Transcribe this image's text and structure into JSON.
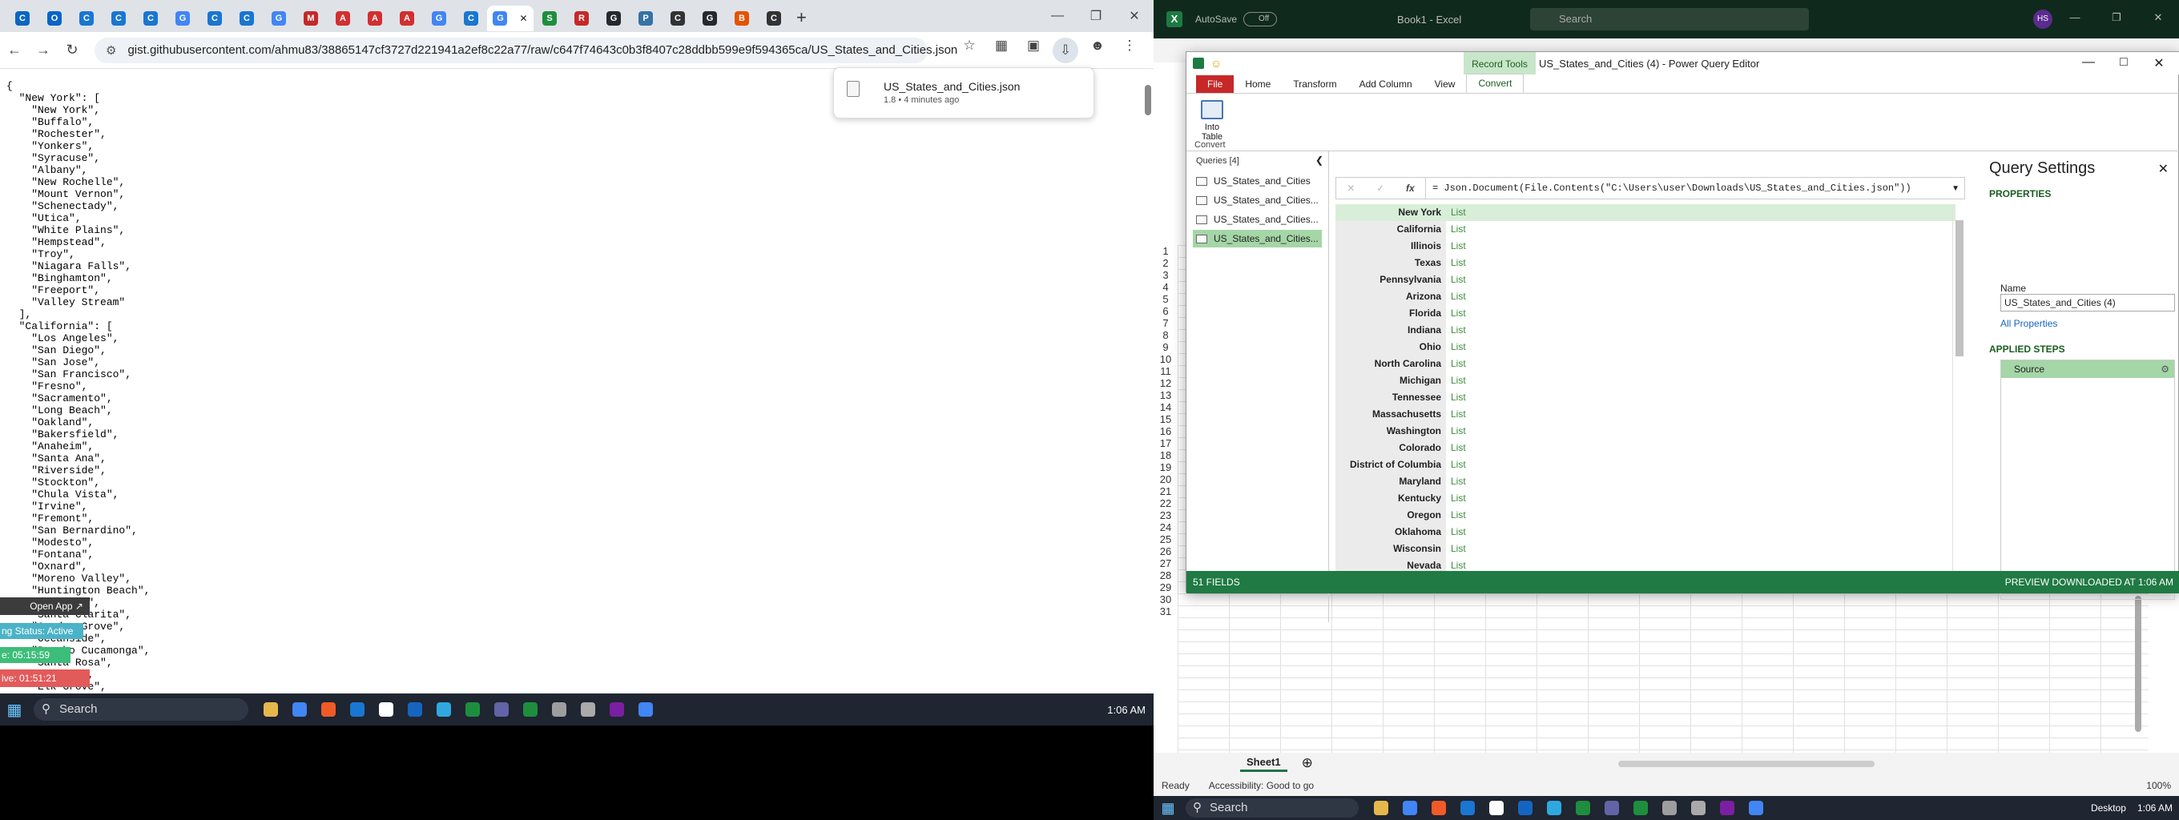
{
  "chrome": {
    "tabs": [
      {
        "icon": "cycle-icon",
        "color": "#0a66c2",
        "letter": "C"
      },
      {
        "icon": "outlook-icon",
        "color": "#0a64c8",
        "letter": "O"
      },
      {
        "icon": "cycle-icon",
        "color": "#1976d2",
        "letter": "C"
      },
      {
        "icon": "cycle-icon",
        "color": "#1976d2",
        "letter": "C"
      },
      {
        "icon": "cycle-icon",
        "color": "#1976d2",
        "letter": "C"
      },
      {
        "icon": "google-icon",
        "color": "#4285f4",
        "letter": "G"
      },
      {
        "icon": "cycle-icon",
        "color": "#1976d2",
        "letter": "C"
      },
      {
        "icon": "cycle-icon",
        "color": "#1976d2",
        "letter": "C"
      },
      {
        "icon": "google-icon",
        "color": "#4285f4",
        "letter": "G"
      },
      {
        "icon": "gmail-icon",
        "color": "#c62828",
        "letter": "M"
      },
      {
        "icon": "red-app-icon",
        "color": "#d32f2f",
        "letter": "A"
      },
      {
        "icon": "red-app-icon",
        "color": "#d32f2f",
        "letter": "A"
      },
      {
        "icon": "red-app-icon",
        "color": "#d32f2f",
        "letter": "A"
      },
      {
        "icon": "google-icon",
        "color": "#4285f4",
        "letter": "G"
      },
      {
        "icon": "cycle-icon",
        "color": "#1976d2",
        "letter": "C"
      }
    ],
    "active_tab_letter": "G",
    "tabs_after": [
      {
        "icon": "sheets-icon",
        "color": "#1e8e3e",
        "letter": "S"
      },
      {
        "icon": "red-app-icon",
        "color": "#c62828",
        "letter": "R"
      },
      {
        "icon": "github-icon",
        "color": "#24292f",
        "letter": "G"
      },
      {
        "icon": "python-icon",
        "color": "#3572a5",
        "letter": "P"
      },
      {
        "icon": "chatgpt-icon",
        "color": "#333333",
        "letter": "C"
      },
      {
        "icon": "github-icon",
        "color": "#24292f",
        "letter": "G"
      },
      {
        "icon": "brave-icon",
        "color": "#e65100",
        "letter": "B"
      },
      {
        "icon": "chatgpt-icon",
        "color": "#333333",
        "letter": "C"
      }
    ],
    "url": "gist.githubusercontent.com/ahmu83/38865147cf3727d221941a2ef8c22a77/raw/c647f74643c0b3f8407c28ddbb599e9f594365ca/US_States_and_Cities.json",
    "json_text": "{\n  \"New York\": [\n    \"New York\",\n    \"Buffalo\",\n    \"Rochester\",\n    \"Yonkers\",\n    \"Syracuse\",\n    \"Albany\",\n    \"New Rochelle\",\n    \"Mount Vernon\",\n    \"Schenectady\",\n    \"Utica\",\n    \"White Plains\",\n    \"Hempstead\",\n    \"Troy\",\n    \"Niagara Falls\",\n    \"Binghamton\",\n    \"Freeport\",\n    \"Valley Stream\"\n  ],\n  \"California\": [\n    \"Los Angeles\",\n    \"San Diego\",\n    \"San Jose\",\n    \"San Francisco\",\n    \"Fresno\",\n    \"Sacramento\",\n    \"Long Beach\",\n    \"Oakland\",\n    \"Bakersfield\",\n    \"Anaheim\",\n    \"Santa Ana\",\n    \"Riverside\",\n    \"Stockton\",\n    \"Chula Vista\",\n    \"Irvine\",\n    \"Fremont\",\n    \"San Bernardino\",\n    \"Modesto\",\n    \"Fontana\",\n    \"Oxnard\",\n    \"Moreno Valley\",\n    \"Huntington Beach\",\n    \"Glendale\",\n    \"Santa Clarita\",\n    \"Garden Grove\",\n    \"Oceanside\",\n    \"Rancho Cucamonga\",\n    \"Santa Rosa\",\n    \"Ontario\",\n    \"Elk Grove\",\n    \"Corona\",",
    "download": {
      "filename": "US_States_and_Cities.json",
      "meta": "1.8 • 4 minutes ago"
    },
    "overlays": {
      "open_app": "Open App ↗",
      "status": "ng Status: Active",
      "timer1": "e: 05:15:59",
      "timer2": "ive: 01:51:21"
    },
    "taskbar": {
      "search": "Search",
      "clock": "1:06 AM"
    }
  },
  "excel": {
    "autosave": "AutoSave",
    "autosave_state": "Off",
    "book": "Book1 - Excel",
    "search": "Search",
    "avatar": "HS",
    "rows": [
      "1",
      "2",
      "3",
      "4",
      "5",
      "6",
      "7",
      "8",
      "9",
      "10",
      "11",
      "12",
      "13",
      "14",
      "15",
      "16",
      "17",
      "18",
      "19",
      "20",
      "21",
      "22",
      "23",
      "24",
      "25",
      "26",
      "27",
      "28",
      "29",
      "30",
      "31"
    ],
    "sheet": "Sheet1",
    "status_ready": "Ready",
    "status_acc": "Accessibility: Good to go",
    "status_zoom": "100%",
    "taskbar_search": "Search",
    "taskbar_clock": "1:06 AM",
    "taskbar_desktop": "Desktop"
  },
  "pq": {
    "record_tools": "Record Tools",
    "title": "US_States_and_Cities (4) - Power Query Editor",
    "tabs": [
      "File",
      "Home",
      "Transform",
      "Add Column",
      "View",
      "Convert"
    ],
    "ribbon_button": "Into Table",
    "ribbon_group": "Convert",
    "queries_header": "Queries [4]",
    "queries": [
      "US_States_and_Cities",
      "US_States_and_Cities...",
      "US_States_and_Cities...",
      "US_States_and_Cities..."
    ],
    "formula": "= Json.Document(File.Contents(\"C:\\Users\\user\\Downloads\\US_States_and_Cities.json\"))",
    "fields": [
      [
        "New York",
        "List"
      ],
      [
        "California",
        "List"
      ],
      [
        "Illinois",
        "List"
      ],
      [
        "Texas",
        "List"
      ],
      [
        "Pennsylvania",
        "List"
      ],
      [
        "Arizona",
        "List"
      ],
      [
        "Florida",
        "List"
      ],
      [
        "Indiana",
        "List"
      ],
      [
        "Ohio",
        "List"
      ],
      [
        "North Carolina",
        "List"
      ],
      [
        "Michigan",
        "List"
      ],
      [
        "Tennessee",
        "List"
      ],
      [
        "Massachusetts",
        "List"
      ],
      [
        "Washington",
        "List"
      ],
      [
        "Colorado",
        "List"
      ],
      [
        "District of Columbia",
        "List"
      ],
      [
        "Maryland",
        "List"
      ],
      [
        "Kentucky",
        "List"
      ],
      [
        "Oregon",
        "List"
      ],
      [
        "Oklahoma",
        "List"
      ],
      [
        "Wisconsin",
        "List"
      ],
      [
        "Nevada",
        "List"
      ]
    ],
    "settings": {
      "title": "Query Settings",
      "properties": "PROPERTIES",
      "name_label": "Name",
      "name_value": "US_States_and_Cities (4)",
      "all_props": "All Properties",
      "applied_steps": "APPLIED STEPS",
      "step": "Source"
    },
    "status_left": "51 FIELDS",
    "status_right": "PREVIEW DOWNLOADED AT 1:06 AM"
  }
}
